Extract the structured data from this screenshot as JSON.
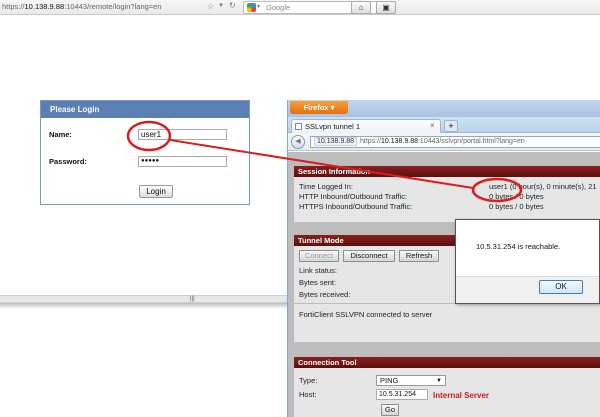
{
  "back_browser": {
    "url_prefix": "https://",
    "url_host": "10.138.9.88",
    "url_rest": ":10443/remote/login?lang=en",
    "search_placeholder": "Google"
  },
  "login": {
    "title": "Please Login",
    "name_label": "Name:",
    "name_value": "user1",
    "password_label": "Password:",
    "password_value": "●●●●●",
    "button": "Login"
  },
  "front_browser": {
    "firefox_label": "Firefox",
    "tab_label": "SSLvpn tunnel 1",
    "tab_close": "×",
    "new_tab": "+",
    "url_ip_box": "10.138.9.88",
    "url_prefix": "https://",
    "url_host": "10.138.9.88",
    "url_rest": ":10443/sslvpn/portal.html?lang=en"
  },
  "session": {
    "title": "Session Information",
    "rows": [
      {
        "label": "Time Logged In:",
        "value": "user1 (0 hour(s), 0 minute(s), 21"
      },
      {
        "label": "HTTP Inbound/Outbound Traffic:",
        "value": "0 bytes / 0 bytes"
      },
      {
        "label": "HTTPS Inbound/Outbound Traffic:",
        "value": "0 bytes / 0 bytes"
      }
    ]
  },
  "tunnel": {
    "title": "Tunnel Mode",
    "connect": "Connect",
    "disconnect": "Disconnect",
    "refresh": "Refresh",
    "link_status": "Link status:",
    "bytes_sent": "Bytes sent:",
    "bytes_received": "Bytes received:",
    "message": "FortiClient SSLVPN connected to server"
  },
  "connection_tool": {
    "title": "Connection Tool",
    "type_label": "Type:",
    "type_value": "PING",
    "host_label": "Host:",
    "host_value": "10.5.31.254",
    "go": "Go"
  },
  "dialog": {
    "message": "10.5.31.254 is reachable.",
    "ok": "OK"
  },
  "annotation": {
    "internal_server": "Internal Server"
  },
  "colors": {
    "login_header": "#5b7fb2",
    "section_header": "#7a1a1a",
    "annotation_red": "#d81e1e",
    "firefox_orange": "#e8801c"
  }
}
